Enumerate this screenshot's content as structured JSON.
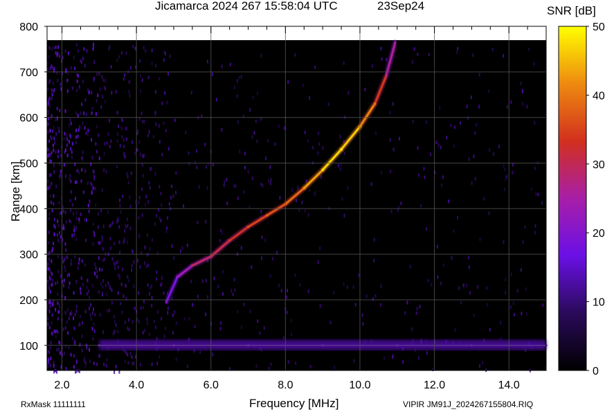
{
  "header": {
    "title_left": "Jicamarca 2024 267 15:58:04 UTC",
    "title_right": "23Sep24"
  },
  "footer": {
    "rxmask": "RxMask 11111111",
    "filename": "VIPIR  JM91J_2024267155804.RIQ"
  },
  "colorbar": {
    "title": "SNR [dB]",
    "ticks": [
      "0",
      "10",
      "20",
      "30",
      "40",
      "50"
    ],
    "range": [
      0,
      50
    ],
    "colors": [
      "#000000",
      "#2a0a5a",
      "#6a10e6",
      "#a81ea8",
      "#d2301e",
      "#ee8a10",
      "#ffff00"
    ]
  },
  "chart_data": {
    "type": "heatmap",
    "title": "Jicamarca 2024 267 15:58:04 UTC",
    "xlabel": "Frequency [MHz]",
    "ylabel": "Range [km]",
    "xlim": [
      1.6,
      15.0
    ],
    "ylim": [
      45,
      800
    ],
    "x_tick_labels": [
      "2.0",
      "4.0",
      "6.0",
      "8.0",
      "10.0",
      "12.0",
      "14.0"
    ],
    "y_tick_labels": [
      "100",
      "200",
      "300",
      "400",
      "500",
      "600",
      "700",
      "800"
    ],
    "grid": true,
    "colorbar_label": "SNR [dB]",
    "colorbar_range": [
      0,
      50
    ],
    "traces": [
      {
        "name": "",
        "points": [
          {
            "freq": 4.8,
            "range": 195,
            "snr": 14
          },
          {
            "freq": 5.1,
            "range": 250,
            "snr": 16
          },
          {
            "freq": 5.5,
            "range": 275,
            "snr": 24
          },
          {
            "freq": 6.0,
            "range": 295,
            "snr": 26
          },
          {
            "freq": 6.5,
            "range": 330,
            "snr": 28
          },
          {
            "freq": 7.0,
            "range": 360,
            "snr": 30
          },
          {
            "freq": 7.5,
            "range": 385,
            "snr": 32
          },
          {
            "freq": 8.0,
            "range": 410,
            "snr": 33
          },
          {
            "freq": 8.5,
            "range": 445,
            "snr": 36
          },
          {
            "freq": 9.0,
            "range": 485,
            "snr": 42
          },
          {
            "freq": 9.5,
            "range": 530,
            "snr": 44
          },
          {
            "freq": 10.0,
            "range": 580,
            "snr": 40
          },
          {
            "freq": 10.4,
            "range": 630,
            "snr": 34
          },
          {
            "freq": 10.7,
            "range": 690,
            "snr": 26
          },
          {
            "freq": 10.95,
            "range": 765,
            "snr": 18
          }
        ]
      },
      {
        "name": "",
        "points": [
          {
            "freq": 3.0,
            "range": 100,
            "snr": 14
          },
          {
            "freq": 5.0,
            "range": 100,
            "snr": 15
          },
          {
            "freq": 7.0,
            "range": 100,
            "snr": 14
          },
          {
            "freq": 9.0,
            "range": 100,
            "snr": 13
          },
          {
            "freq": 11.0,
            "range": 100,
            "snr": 13
          },
          {
            "freq": 13.0,
            "range": 100,
            "snr": 12
          },
          {
            "freq": 15.0,
            "range": 100,
            "snr": 13
          }
        ]
      }
    ]
  }
}
